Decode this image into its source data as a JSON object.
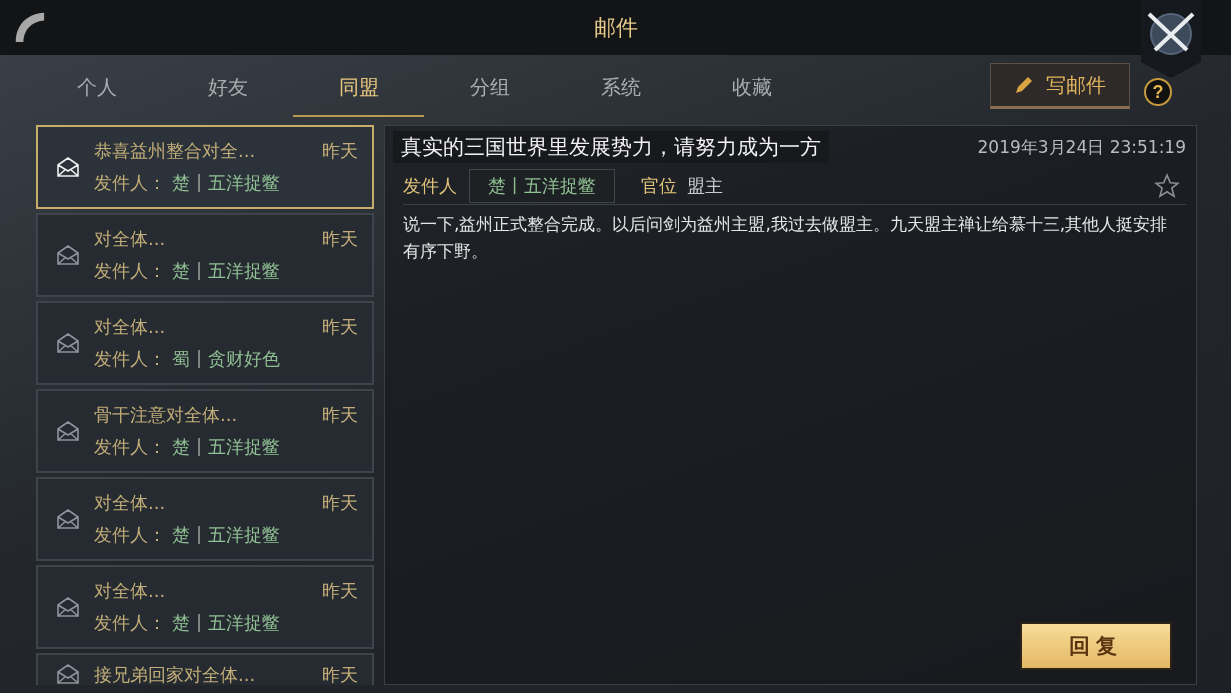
{
  "header": {
    "title": "邮件"
  },
  "tabs": [
    {
      "label": "个人",
      "selected": false
    },
    {
      "label": "好友",
      "selected": false
    },
    {
      "label": "同盟",
      "selected": true
    },
    {
      "label": "分组",
      "selected": false
    },
    {
      "label": "系统",
      "selected": false
    },
    {
      "label": "收藏",
      "selected": false
    }
  ],
  "compose_button": "写邮件",
  "help_button": "?",
  "mails": [
    {
      "subject": "恭喜益州整合对全...",
      "time": "昨天",
      "sender_label": "发件人：",
      "sender_country": "楚",
      "separator": "|",
      "sender_name": "五洋捉鳖",
      "selected": true
    },
    {
      "subject": "对全体...",
      "time": "昨天",
      "sender_label": "发件人：",
      "sender_country": "楚",
      "separator": "|",
      "sender_name": "五洋捉鳖",
      "selected": false
    },
    {
      "subject": "对全体...",
      "time": "昨天",
      "sender_label": "发件人：",
      "sender_country": "蜀",
      "separator": "|",
      "sender_name": "贪财好色",
      "selected": false
    },
    {
      "subject": "骨干注意对全体...",
      "time": "昨天",
      "sender_label": "发件人：",
      "sender_country": "楚",
      "separator": "|",
      "sender_name": "五洋捉鳖",
      "selected": false
    },
    {
      "subject": "对全体...",
      "time": "昨天",
      "sender_label": "发件人：",
      "sender_country": "楚",
      "separator": "|",
      "sender_name": "五洋捉鳖",
      "selected": false
    },
    {
      "subject": "对全体...",
      "time": "昨天",
      "sender_label": "发件人：",
      "sender_country": "楚",
      "separator": "|",
      "sender_name": "五洋捉鳖",
      "selected": false
    },
    {
      "subject": "接兄弟回家对全体...",
      "time": "昨天",
      "selected": false
    }
  ],
  "toast": "真实的三国世界里发展势力，请努力成为一方",
  "detail": {
    "date": "2019年3月24日 23:51:19",
    "sender_label": "发件人",
    "sender": "楚丨五洋捉鳖",
    "rank_label": "官位",
    "rank": "盟主",
    "favorited": false,
    "body": "说一下,益州正式整合完成。以后问剑为益州主盟,我过去做盟主。九天盟主禅让给慕十三,其他人挺安排有序下野。",
    "reply_button": "回复"
  }
}
